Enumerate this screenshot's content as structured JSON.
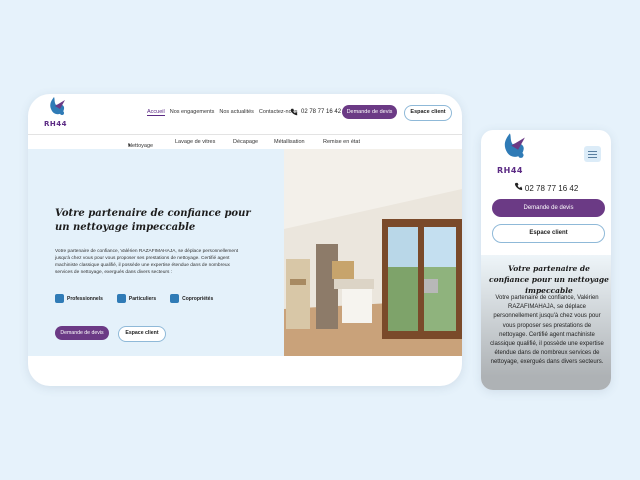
{
  "brand": {
    "logo_text": "RH44"
  },
  "nav": {
    "items": [
      "Accueil",
      "Nos engagements",
      "Nos actualités",
      "Contactez-nous"
    ]
  },
  "contact": {
    "phone": "02 78 77 16 42"
  },
  "buttons": {
    "quote": "Demande de devis",
    "client": "Espace client"
  },
  "submenu": {
    "items": [
      "Nettoyage",
      "Lavage de vitres",
      "Décapage",
      "Métallisation",
      "Remise en état"
    ]
  },
  "hero": {
    "title": "Votre partenaire de confiance pour un nettoyage impeccable",
    "paragraph": "Votre partenaire de confiance, Valérien RAZAFIMAHAJA, se déplace personnellement jusqu'à chez vous pour vous proposer ses prestations de nettoyage. Certifié agent machiniste classique qualifié, il possède une expertise étendue dans de nombreux services de nettoyage, exergués dans divers secteurs :",
    "features": [
      "Professionnels",
      "Particuliers",
      "Copropriétés"
    ]
  },
  "mobile": {
    "title": "Votre partenaire de confiance pour un nettoyage impeccable",
    "paragraph": "Votre partenaire de confiance, Valérien RAZAFIMAHAJA, se déplace personnellement jusqu'à chez vous pour vous proposer ses prestations de nettoyage. Certifié agent machiniste classique qualifié, il possède une expertise étendue dans de nombreux services de nettoyage, exergués dans divers secteurs."
  },
  "colors": {
    "brand_purple": "#6b3a85",
    "hero_bg": "#e4f1fa",
    "page_bg": "#e6f2fb"
  }
}
